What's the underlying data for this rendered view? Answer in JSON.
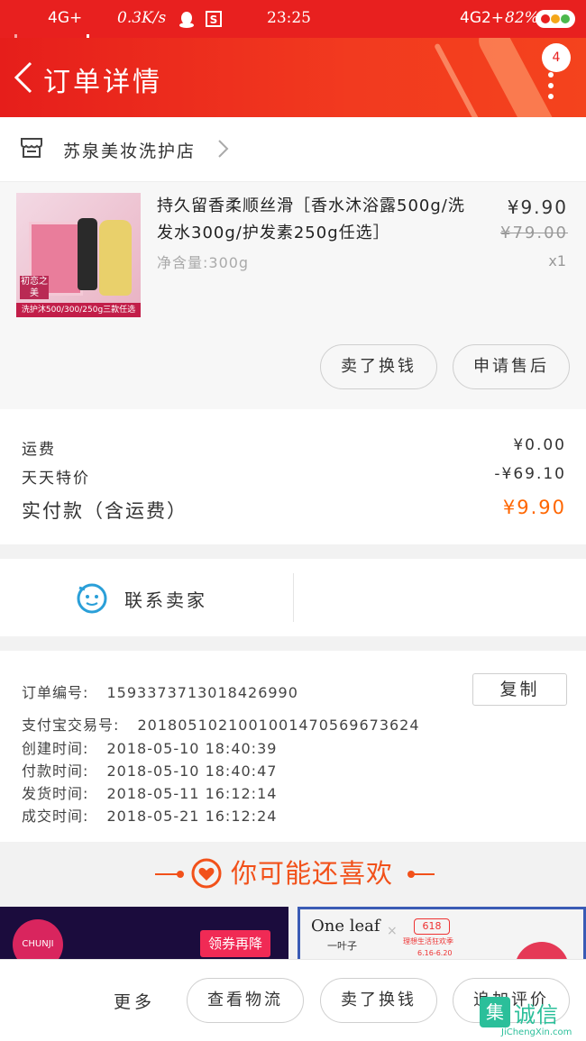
{
  "status_bar": {
    "network_left": "4G+",
    "speed": "0.3K/s",
    "time": "23:25",
    "network_right": "4G2+",
    "battery": "82%"
  },
  "header": {
    "title": "订单详情",
    "notification_count": "4"
  },
  "store": {
    "name": "苏泉美妆洗护店"
  },
  "product": {
    "title": "持久留香柔顺丝滑［香水沐浴露500g/洗发水300g/护发素250g任选］",
    "spec": "净含量:300g",
    "price": "¥9.90",
    "original_price": "¥79.00",
    "quantity": "x1",
    "image_tag": "洗护沐500/300/250g三款任选",
    "image_label": "初恋之美",
    "buttons": {
      "sell_money": "卖了换钱",
      "after_sale": "申请售后"
    }
  },
  "summary": {
    "shipping_label": "运费",
    "shipping_value": "¥0.00",
    "discount_label": "天天特价",
    "discount_value": "-¥69.10",
    "total_label": "实付款（含运费）",
    "total_value": "¥9.90"
  },
  "contact": {
    "label": "联系卖家"
  },
  "order_info": {
    "order_no_label": "订单编号:",
    "order_no": "1593373713018426990",
    "copy_button": "复制",
    "alipay_label": "支付宝交易号:",
    "alipay_no": "2018051021001001470569673624",
    "created_label": "创建时间:",
    "created": "2018-05-10 18:40:39",
    "paid_label": "付款时间:",
    "paid": "2018-05-10 18:40:47",
    "shipped_label": "发货时间:",
    "shipped": "2018-05-11 16:12:14",
    "completed_label": "成交时间:",
    "completed": "2018-05-21 16:12:24"
  },
  "recommend": {
    "title": "你可能还喜欢",
    "banner_left": {
      "logo": "CHUNJI",
      "coupon": "领券再降"
    },
    "banner_right": {
      "brand": "One leaf",
      "brand_cn": "一叶子",
      "promo": "618",
      "promo_sub": "理想生活狂欢季",
      "promo_date": "6.16-6.20"
    }
  },
  "bottom_bar": {
    "more": "更多",
    "view_logistics": "查看物流",
    "sell_money": "卖了换钱",
    "add_review": "追加评价"
  },
  "watermark": {
    "mark": "集",
    "cn": "诚信",
    "en": "JiChengXin.com"
  },
  "colors": {
    "header_red": "#e8201f",
    "accent_orange": "#ff6600",
    "recommend_orange": "#f2511a",
    "contact_blue": "#2a9fd8"
  }
}
